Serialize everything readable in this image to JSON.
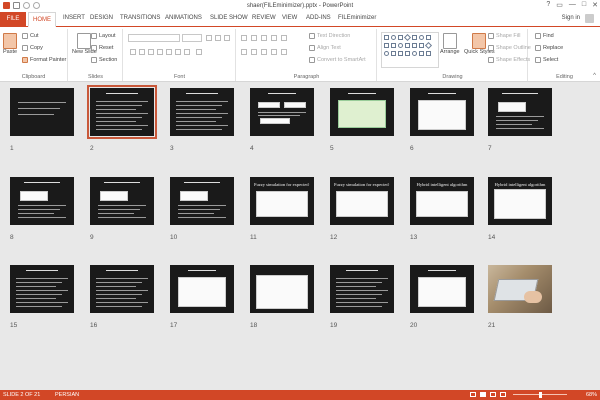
{
  "window": {
    "title": "shaer(FILEminimizer).pptx - PowerPoint",
    "controls": [
      "?",
      "▭",
      "—",
      "□",
      "✕"
    ]
  },
  "tabs": [
    "FILE",
    "HOME",
    "INSERT",
    "DESIGN",
    "TRANSITIONS",
    "ANIMATIONS",
    "SLIDE SHOW",
    "REVIEW",
    "VIEW",
    "ADD-INS",
    "FILEminimizer"
  ],
  "active_tab": "HOME",
  "signin": "Sign in",
  "ribbon": {
    "clipboard": {
      "label": "Clipboard",
      "paste": "Paste",
      "cut": "Cut",
      "copy": "Copy",
      "format_painter": "Format Painter"
    },
    "slides": {
      "label": "Slides",
      "new_slide": "New Slide",
      "layout": "Layout",
      "reset": "Reset",
      "section": "Section"
    },
    "font": {
      "label": "Font"
    },
    "paragraph": {
      "label": "Paragraph",
      "text_direction": "Text Direction",
      "align_text": "Align Text",
      "convert_smartart": "Convert to SmartArt"
    },
    "drawing": {
      "label": "Drawing",
      "arrange": "Arrange",
      "quick_styles": "Quick Styles",
      "shape_fill": "Shape Fill",
      "shape_outline": "Shape Outline",
      "shape_effects": "Shape Effects"
    },
    "editing": {
      "label": "Editing",
      "find": "Find",
      "replace": "Replace",
      "select": "Select"
    }
  },
  "slides": [
    {
      "n": "1",
      "kind": "title-rtl",
      "title": ""
    },
    {
      "n": "2",
      "kind": "text",
      "title": ""
    },
    {
      "n": "3",
      "kind": "text",
      "title": ""
    },
    {
      "n": "4",
      "kind": "boxes",
      "title": ""
    },
    {
      "n": "5",
      "kind": "green",
      "title": ""
    },
    {
      "n": "6",
      "kind": "table",
      "title": ""
    },
    {
      "n": "7",
      "kind": "box-text",
      "title": ""
    },
    {
      "n": "8",
      "kind": "box-text",
      "title": ""
    },
    {
      "n": "9",
      "kind": "box-text",
      "title": ""
    },
    {
      "n": "10",
      "kind": "box-text",
      "title": ""
    },
    {
      "n": "11",
      "kind": "eng",
      "title": "Fuzzy simulation for expected value"
    },
    {
      "n": "12",
      "kind": "eng",
      "title": "Fuzzy simulation for expected value"
    },
    {
      "n": "13",
      "kind": "eng",
      "title": "Hybrid intelligent algorithm"
    },
    {
      "n": "14",
      "kind": "eng-white",
      "title": "Hybrid intelligent algorithm"
    },
    {
      "n": "15",
      "kind": "text",
      "title": ""
    },
    {
      "n": "16",
      "kind": "text",
      "title": ""
    },
    {
      "n": "17",
      "kind": "table",
      "title": ""
    },
    {
      "n": "18",
      "kind": "chart",
      "title": ""
    },
    {
      "n": "19",
      "kind": "text",
      "title": ""
    },
    {
      "n": "20",
      "kind": "table",
      "title": ""
    },
    {
      "n": "21",
      "kind": "photo",
      "title": ""
    }
  ],
  "selected_slide": "2",
  "status": {
    "slide": "SLIDE 2 OF 21",
    "language": "PERSIAN",
    "zoom": "68%",
    "zoom_fraction": 0.68
  }
}
